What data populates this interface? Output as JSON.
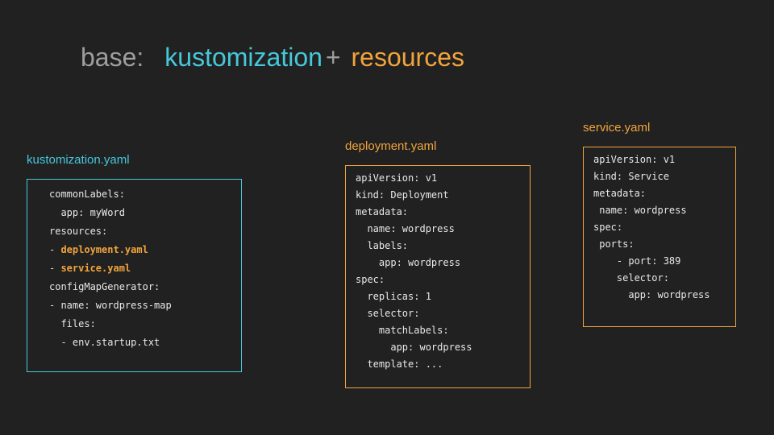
{
  "title": {
    "base": "base:",
    "kustomization": "kustomization",
    "plus": "+",
    "resources": "resources"
  },
  "colors": {
    "background": "#212121",
    "title_gray": "#9e9e9e",
    "accent_cyan": "#46c8db",
    "accent_orange": "#f2a43c",
    "code_text": "#e8e8e8"
  },
  "panels": [
    {
      "label": "kustomization.yaml",
      "accent": "#46c8db",
      "lines": [
        [
          {
            "text": "commonLabels:"
          }
        ],
        [
          {
            "text": "  app: myWord"
          }
        ],
        [
          {
            "text": "resources:"
          }
        ],
        [
          {
            "text": "- "
          },
          {
            "text": "deployment.yaml",
            "highlight": true
          }
        ],
        [
          {
            "text": "- "
          },
          {
            "text": "service.yaml",
            "highlight": true
          }
        ],
        [
          {
            "text": "configMapGenerator:"
          }
        ],
        [
          {
            "text": "- name: wordpress-map"
          }
        ],
        [
          {
            "text": "  files:"
          }
        ],
        [
          {
            "text": "  - env.startup.txt"
          }
        ]
      ]
    },
    {
      "label": "deployment.yaml",
      "accent": "#f2a43c",
      "lines": [
        [
          {
            "text": "apiVersion: v1"
          }
        ],
        [
          {
            "text": "kind: Deployment"
          }
        ],
        [
          {
            "text": "metadata:"
          }
        ],
        [
          {
            "text": "  name: wordpress"
          }
        ],
        [
          {
            "text": "  labels:"
          }
        ],
        [
          {
            "text": "    app: wordpress"
          }
        ],
        [
          {
            "text": "spec:"
          }
        ],
        [
          {
            "text": "  replicas: 1"
          }
        ],
        [
          {
            "text": "  selector:"
          }
        ],
        [
          {
            "text": "    matchLabels:"
          }
        ],
        [
          {
            "text": "      app: wordpress"
          }
        ],
        [
          {
            "text": "  template: ..."
          }
        ]
      ]
    },
    {
      "label": "service.yaml",
      "accent": "#f2a43c",
      "lines": [
        [
          {
            "text": "apiVersion: v1"
          }
        ],
        [
          {
            "text": "kind: Service"
          }
        ],
        [
          {
            "text": "metadata:"
          }
        ],
        [
          {
            "text": " name: wordpress"
          }
        ],
        [
          {
            "text": "spec:"
          }
        ],
        [
          {
            "text": " ports:"
          }
        ],
        [
          {
            "text": "    - port: 389"
          }
        ],
        [
          {
            "text": "    selector:"
          }
        ],
        [
          {
            "text": "      app: wordpress"
          }
        ]
      ]
    }
  ]
}
